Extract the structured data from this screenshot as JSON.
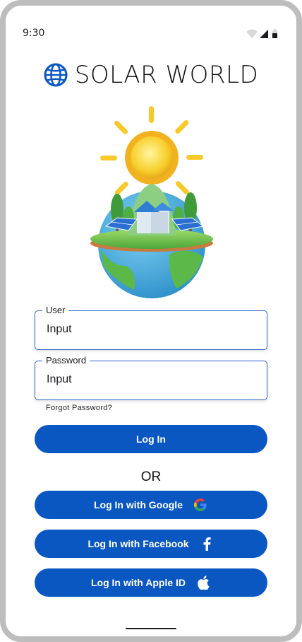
{
  "status_bar": {
    "time": "9:30",
    "icons": [
      "wifi-icon",
      "signal-icon",
      "battery-icon"
    ]
  },
  "brand": {
    "title": "SOLAR WORLD",
    "icon": "globe-icon",
    "color": "#0b57c2"
  },
  "hero": {
    "image": "solar-earth-illustration"
  },
  "form": {
    "user": {
      "label": "User",
      "value": "Input"
    },
    "password": {
      "label": "Password",
      "value": "Input"
    },
    "forgot_password": "Forgot Password?"
  },
  "buttons": {
    "login": "Log In",
    "or": "OR",
    "google": {
      "label": "Log In with Google",
      "icon": "google-icon"
    },
    "facebook": {
      "label": "Log In with Facebook",
      "icon": "facebook-icon"
    },
    "apple": {
      "label": "Log In with Apple ID",
      "icon": "apple-icon"
    }
  },
  "colors": {
    "primary": "#0b57c2",
    "field_border": "#2b63c4"
  }
}
